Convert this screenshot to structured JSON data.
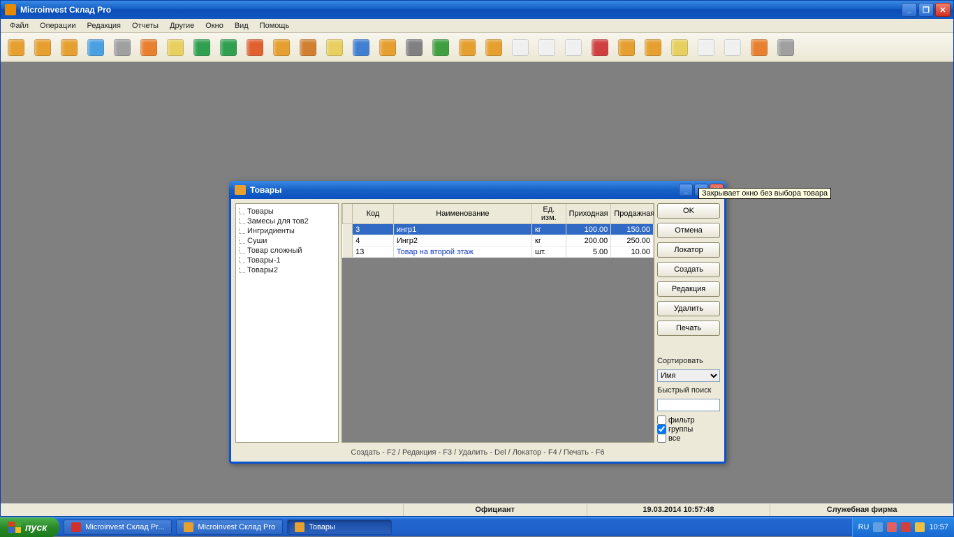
{
  "app": {
    "title": "Microinvest Склад Pro"
  },
  "menu": [
    "Файл",
    "Операции",
    "Редакция",
    "Отчеты",
    "Другие",
    "Окно",
    "Вид",
    "Помощь"
  ],
  "toolbar_icons": [
    {
      "n": "tb-doc-new",
      "c": "#e6a030"
    },
    {
      "n": "tb-doc-open",
      "c": "#e6a030"
    },
    {
      "n": "tb-box",
      "c": "#e6a030"
    },
    {
      "n": "tb-star",
      "c": "#4aa0e0"
    },
    {
      "n": "tb-cloud",
      "c": "#a0a0a0"
    },
    {
      "n": "tb-user",
      "c": "#e88030"
    },
    {
      "n": "tb-note",
      "c": "#e8d060"
    },
    {
      "n": "tb-arrow-r",
      "c": "#30a050"
    },
    {
      "n": "tb-arrow-ok",
      "c": "#30a050"
    },
    {
      "n": "tb-arrow-l",
      "c": "#e06030"
    },
    {
      "n": "tb-clipboard",
      "c": "#e6a030"
    },
    {
      "n": "tb-book",
      "c": "#d08030"
    },
    {
      "n": "tb-mail",
      "c": "#e8d060"
    },
    {
      "n": "tb-person",
      "c": "#4080d0"
    },
    {
      "n": "tb-package",
      "c": "#e6a030"
    },
    {
      "n": "tb-keys",
      "c": "#808080"
    },
    {
      "n": "tb-refresh",
      "c": "#40a040"
    },
    {
      "n": "tb-cart",
      "c": "#e6a030"
    },
    {
      "n": "tb-box2",
      "c": "#e6a030"
    },
    {
      "n": "tb-page",
      "c": "#f0f0f0"
    },
    {
      "n": "tb-page2",
      "c": "#f0f0f0"
    },
    {
      "n": "tb-page3",
      "c": "#f0f0f0"
    },
    {
      "n": "tb-recycle",
      "c": "#d04040"
    },
    {
      "n": "tb-paste",
      "c": "#e6a030"
    },
    {
      "n": "tb-paste2",
      "c": "#e6a030"
    },
    {
      "n": "tb-mail2",
      "c": "#e8d060"
    },
    {
      "n": "tb-doc2",
      "c": "#f0f0f0"
    },
    {
      "n": "tb-contact",
      "c": "#f0f0f0"
    },
    {
      "n": "tb-user2",
      "c": "#e88030"
    },
    {
      "n": "tb-gear",
      "c": "#a0a0a0"
    }
  ],
  "dialog": {
    "title": "Товары",
    "tree": [
      "Товары",
      "Замесы для тов2",
      "Ингридиенты",
      "Суши",
      "Товар сложный",
      "Товары-1",
      "Товары2"
    ],
    "columns": [
      "Код",
      "Наименование",
      "Ед. изм.",
      "Приходная",
      "Продажная"
    ],
    "col_widths": [
      "58px",
      "196px",
      "48px",
      "64px",
      "60px"
    ],
    "rows": [
      {
        "code": "3",
        "name": "ингр1",
        "unit": "кг",
        "in": "100.00",
        "out": "150.00",
        "sel": true
      },
      {
        "code": "4",
        "name": "Ингр2",
        "unit": "кг",
        "in": "200.00",
        "out": "250.00"
      },
      {
        "code": "13",
        "name": "Товар на второй этаж",
        "unit": "шт.",
        "in": "5.00",
        "out": "10.00",
        "link": true
      }
    ],
    "buttons": [
      "OK",
      "Отмена",
      "Локатор",
      "Создать",
      "Редакция",
      "Удалить",
      "Печать"
    ],
    "sort_label": "Сортировать",
    "sort_value": "Имя",
    "search_label": "Быстрый поиск",
    "checks": [
      {
        "label": "фильтр",
        "checked": false
      },
      {
        "label": "группы",
        "checked": true
      },
      {
        "label": "все",
        "checked": false
      }
    ],
    "footer": "Создать - F2 / Редакция - F3 / Удалить - Del / Локатор - F4 / Печать - F6"
  },
  "tooltip": "Закрывает окно без выбора товара",
  "status": {
    "user": "Официант",
    "datetime": "19.03.2014 10:57:48",
    "firm": "Служебная фирма"
  },
  "taskbar": {
    "start": "пуск",
    "tasks": [
      {
        "label": "Microinvest Склад Pr...",
        "icon": "#d03030"
      },
      {
        "label": "Microinvest Склад Pro",
        "icon": "#e6a030"
      },
      {
        "label": "Товары",
        "icon": "#e6a030",
        "active": true
      }
    ],
    "lang": "RU",
    "clock": "10:57"
  }
}
